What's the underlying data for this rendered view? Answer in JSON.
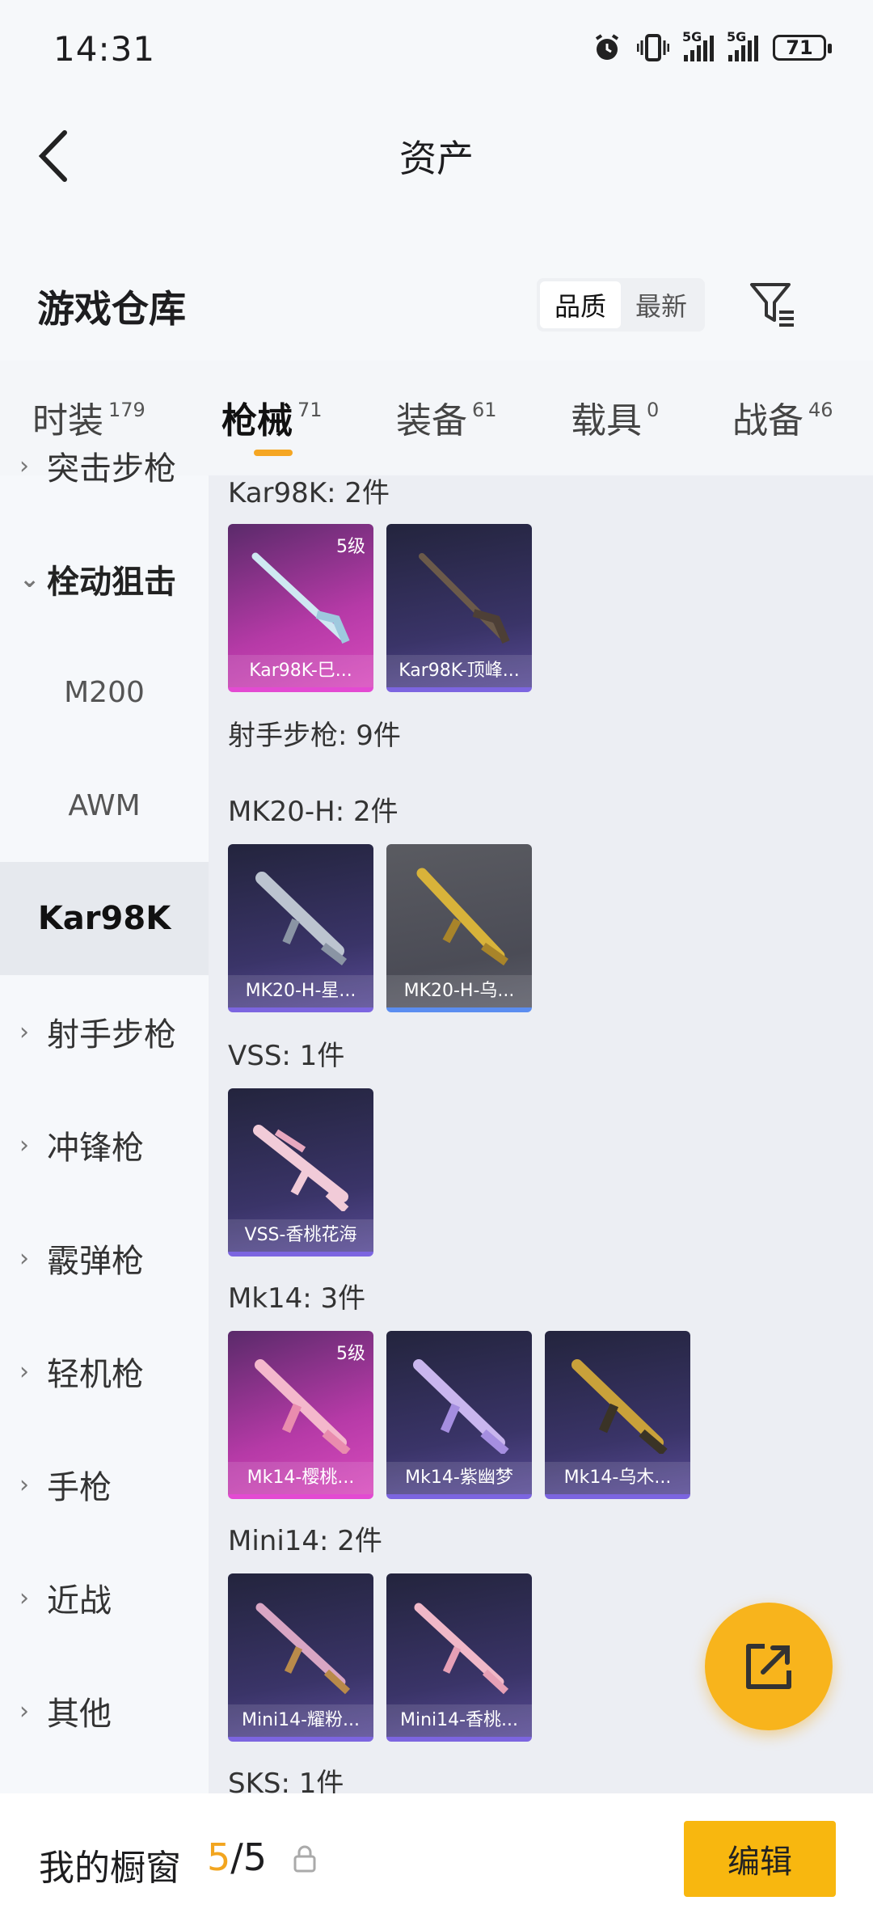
{
  "status": {
    "time": "14:31",
    "signal1": "5G",
    "signal2": "5G",
    "battery": "71"
  },
  "header": {
    "title": "资产"
  },
  "section": {
    "title": "游戏仓库"
  },
  "sort": {
    "options": [
      "品质",
      "最新"
    ],
    "selected": "品质"
  },
  "tabs": [
    {
      "label": "时装",
      "count": "179"
    },
    {
      "label": "枪械",
      "count": "71"
    },
    {
      "label": "装备",
      "count": "61"
    },
    {
      "label": "载具",
      "count": "0"
    },
    {
      "label": "战备",
      "count": "46"
    }
  ],
  "nav": [
    {
      "label": "突击步枪",
      "state": "collapsed"
    },
    {
      "label": "栓动狙击",
      "state": "open"
    },
    {
      "label": "M200",
      "state": "sub"
    },
    {
      "label": "AWM",
      "state": "sub"
    },
    {
      "label": "Kar98K",
      "state": "selected"
    },
    {
      "label": "射手步枪",
      "state": "collapsed"
    },
    {
      "label": "冲锋枪",
      "state": "collapsed"
    },
    {
      "label": "霰弹枪",
      "state": "collapsed"
    },
    {
      "label": "轻机枪",
      "state": "collapsed"
    },
    {
      "label": "手枪",
      "state": "collapsed"
    },
    {
      "label": "近战",
      "state": "collapsed"
    },
    {
      "label": "其他",
      "state": "collapsed"
    }
  ],
  "groups": [
    {
      "label": "Kar98K: 2件",
      "items": [
        {
          "name": "Kar98K-巳...",
          "level": "5级",
          "style": "pink"
        },
        {
          "name": "Kar98K-顶峰...",
          "level": "",
          "style": "purple"
        }
      ]
    },
    {
      "label": "射手步枪: 9件",
      "items": []
    },
    {
      "label": "MK20-H: 2件",
      "items": [
        {
          "name": "MK20-H-星...",
          "level": "",
          "style": "purple"
        },
        {
          "name": "MK20-H-乌...",
          "level": "",
          "style": "gray"
        }
      ]
    },
    {
      "label": "VSS: 1件",
      "items": [
        {
          "name": "VSS-香桃花海",
          "level": "",
          "style": "purple"
        }
      ]
    },
    {
      "label": "Mk14: 3件",
      "items": [
        {
          "name": "Mk14-樱桃...",
          "level": "5级",
          "style": "pink"
        },
        {
          "name": "Mk14-紫幽梦",
          "level": "",
          "style": "purple"
        },
        {
          "name": "Mk14-乌木...",
          "level": "",
          "style": "purple"
        }
      ]
    },
    {
      "label": "Mini14: 2件",
      "items": [
        {
          "name": "Mini14-耀粉...",
          "level": "",
          "style": "purple"
        },
        {
          "name": "Mini14-香桃...",
          "level": "",
          "style": "purple"
        }
      ]
    },
    {
      "label": "SKS: 1件",
      "items": []
    }
  ],
  "bottom": {
    "label": "我的橱窗",
    "current": "5",
    "total": "/5",
    "edit": "编辑"
  },
  "colors": {
    "accent": "#f8b70f",
    "count_highlight": "#f2a51f"
  }
}
